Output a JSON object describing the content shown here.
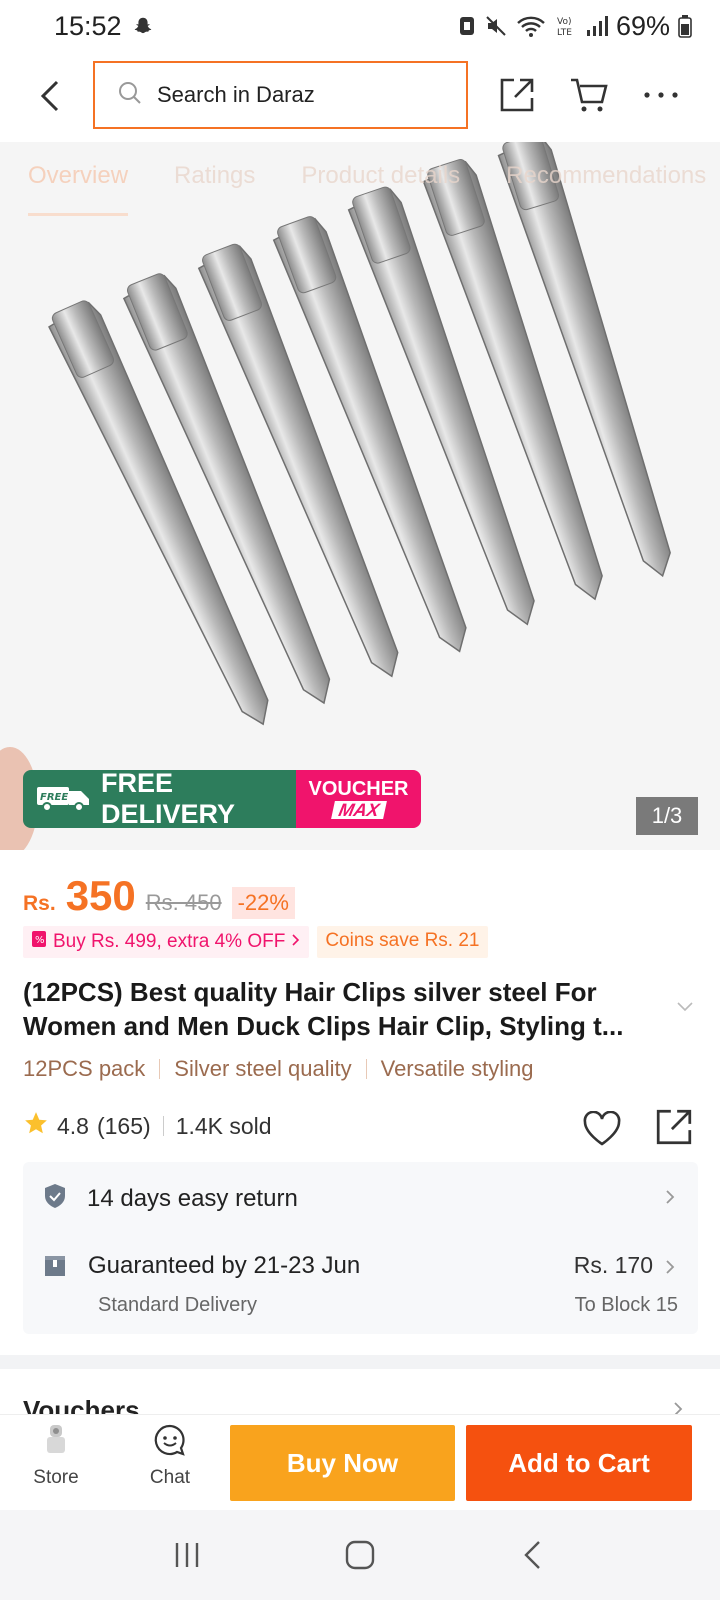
{
  "status_bar": {
    "time": "15:52",
    "battery": "69%"
  },
  "header": {
    "search_placeholder": "Search in Daraz"
  },
  "tabs": [
    "Overview",
    "Ratings",
    "Product details",
    "Recommendations"
  ],
  "hero": {
    "free_delivery_label": "FREE DELIVERY",
    "free_tag": "FREE",
    "voucher_label": "VOUCHER",
    "voucher_max": "MAX",
    "page_indicator": "1/3"
  },
  "price": {
    "currency": "Rs.",
    "current": "350",
    "original": "Rs. 450",
    "discount": "-22%"
  },
  "promos": {
    "bundle": "Buy Rs. 499, extra 4% OFF",
    "coins": "Coins save Rs. 21"
  },
  "product": {
    "title": "(12PCS) Best quality Hair Clips silver steel For Women and Men Duck Clips Hair Clip, Styling t...",
    "features": [
      "12PCS pack",
      "Silver steel quality",
      "Versatile styling"
    ]
  },
  "rating": {
    "score": "4.8",
    "count": "(165)",
    "sold": "1.4K sold"
  },
  "delivery": {
    "return_policy": "14 days easy return",
    "guarantee": "Guaranteed by 21-23 Jun",
    "method": "Standard Delivery",
    "fee": "Rs. 170",
    "destination": "To Block 15"
  },
  "sections": {
    "vouchers": "Vouchers"
  },
  "actions": {
    "store": "Store",
    "chat": "Chat",
    "buy_now": "Buy Now",
    "add_to_cart": "Add to Cart"
  },
  "colors": {
    "accent": "#f57224",
    "buy_now": "#f9a31d",
    "add_to_cart": "#f5510f",
    "free_delivery": "#2d7d5c",
    "voucher": "#f0146c",
    "star": "#fbc02d"
  }
}
